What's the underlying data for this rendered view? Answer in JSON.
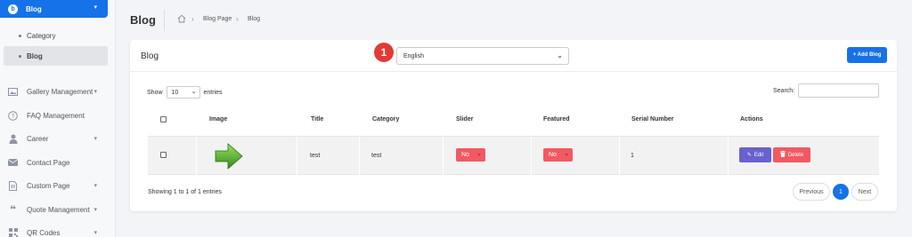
{
  "sidebar": {
    "active": {
      "label": "Blog",
      "icon": "blog-icon"
    },
    "sub_items": [
      {
        "label": "Category"
      },
      {
        "label": "Blog"
      }
    ],
    "items": [
      {
        "label": "Gallery Management",
        "icon": "image-icon",
        "has_caret": true
      },
      {
        "label": "FAQ Management",
        "icon": "question-icon",
        "has_caret": false
      },
      {
        "label": "Career",
        "icon": "user-tie-icon",
        "has_caret": true
      },
      {
        "label": "Contact Page",
        "icon": "envelope-icon",
        "has_caret": false
      },
      {
        "label": "Custom Page",
        "icon": "file-icon",
        "has_caret": true
      },
      {
        "label": "Quote Management",
        "icon": "quote-icon",
        "has_caret": true
      },
      {
        "label": "QR Codes",
        "icon": "qrcode-icon",
        "has_caret": true
      }
    ]
  },
  "header": {
    "title": "Blog",
    "breadcrumb": [
      "Blog Page",
      "Blog"
    ]
  },
  "card": {
    "title": "Blog",
    "language": "English",
    "step_badge": "1",
    "add_button": "+ Add Blog"
  },
  "table_controls": {
    "show_label": "Show",
    "page_size": "10",
    "entries_label": "entries",
    "search_label": "Search:"
  },
  "table": {
    "headers": [
      "Image",
      "Title",
      "Category",
      "Slider",
      "Featured",
      "Serial Number",
      "Actions"
    ],
    "rows": [
      {
        "title": "test",
        "category": "test",
        "slider": "No",
        "featured": "No",
        "serial": "1"
      }
    ],
    "edit_label": "Edit",
    "delete_label": "Delete"
  },
  "footer": {
    "info": "Showing 1 to 1 of 1 entries",
    "previous": "Previous",
    "page": "1",
    "next": "Next"
  },
  "colors": {
    "primary": "#1572e8",
    "danger": "#f25961",
    "secondary": "#6861ce",
    "badge": "#e53935"
  }
}
